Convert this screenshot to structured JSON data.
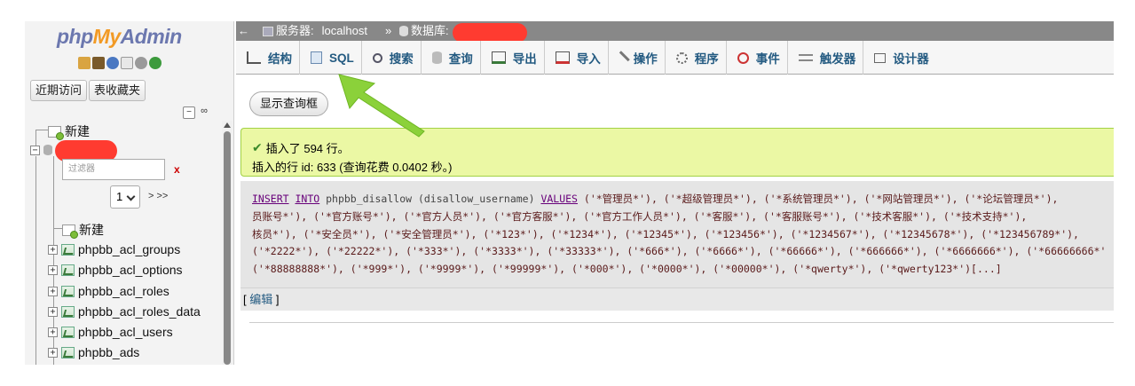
{
  "nav": {
    "logo": {
      "php": "php",
      "my": "My",
      "admin": "Admin"
    },
    "recent_label": "近期访问",
    "favorites_label": "表收藏夹",
    "new_label": "新建",
    "filter_placeholder": "过滤器",
    "filter_clear": "x",
    "page_value": "1",
    "page_next": "> >>",
    "db_new_label": "新建",
    "tables": [
      "phpbb_acl_groups",
      "phpbb_acl_options",
      "phpbb_acl_roles",
      "phpbb_acl_roles_data",
      "phpbb_acl_users",
      "phpbb_ads"
    ]
  },
  "topbar": {
    "back": "←",
    "server_label": "服务器:",
    "server_value": "localhost",
    "separator": "»",
    "db_label": "数据库:"
  },
  "tabs": [
    {
      "label": "结构",
      "icon": "structure-icon"
    },
    {
      "label": "SQL",
      "icon": "sql-icon"
    },
    {
      "label": "搜索",
      "icon": "search-icon"
    },
    {
      "label": "查询",
      "icon": "query-icon"
    },
    {
      "label": "导出",
      "icon": "export-icon"
    },
    {
      "label": "导入",
      "icon": "import-icon"
    },
    {
      "label": "操作",
      "icon": "wrench-icon"
    },
    {
      "label": "程序",
      "icon": "routines-icon"
    },
    {
      "label": "事件",
      "icon": "clock-icon"
    },
    {
      "label": "触发器",
      "icon": "triggers-icon"
    },
    {
      "label": "设计器",
      "icon": "designer-icon"
    }
  ],
  "main": {
    "show_query_button": "显示查询框",
    "success_line1": "插入了 594 行。",
    "success_line2": "插入的行 id: 633 (查询花费 0.0402 秒。)",
    "sql": {
      "kw_insert": "INSERT",
      "kw_into": "INTO",
      "table_part": " phpbb_disallow (disallow_username) ",
      "kw_values": "VALUES",
      "line1_rest": " ('*管理员*'), ('*超级管理员*'), ('*系统管理员*'), ('*网站管理员*'), ('*论坛管理员*'),",
      "line2": "员账号*'), ('*官方账号*'), ('*官方人员*'), ('*官方客服*'), ('*官方工作人员*'), ('*客服*'), ('*客服账号*'), ('*技术客服*'), ('*技术支持*'),",
      "line3": "核员*'), ('*安全员*'), ('*安全管理员*'), ('*123*'), ('*1234*'), ('*12345*'), ('*123456*'), ('*1234567*'), ('*12345678*'), ('*123456789*'),",
      "line4": "('*2222*'), ('*22222*'), ('*333*'), ('*3333*'), ('*33333*'), ('*666*'), ('*6666*'), ('*66666*'), ('*666666*'), ('*6666666*'), ('*66666666*'",
      "line5": "('*88888888*'), ('*999*'), ('*9999*'), ('*99999*'), ('*000*'), ('*0000*'), ('*00000*'), ('*qwerty*'), ('*qwerty123*')[...]"
    },
    "edit_open": "[",
    "edit_link": " 编辑 ",
    "edit_close": "]"
  },
  "colors": {
    "accent": "#235a81",
    "success_bg": "#ebf8a4",
    "redaction": "#ff3b30",
    "arrow": "#8bd13a"
  }
}
